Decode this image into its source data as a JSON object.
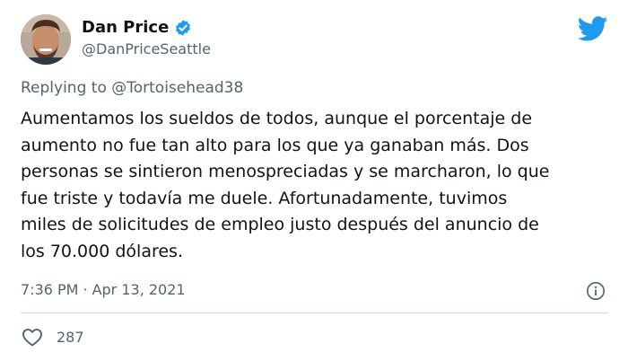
{
  "author": {
    "name": "Dan Price",
    "handle": "@DanPriceSeattle",
    "verified": true
  },
  "reply": {
    "prefix": "Replying to",
    "mention": "@Tortoisehead38"
  },
  "tweet": {
    "lines": [
      "Aumentamos los sueldos de todos, aunque el porcentaje de",
      "aumento no fue tan alto para los que ya ganaban más. Dos",
      "personas se sintieron menospreciadas y se marcharon, lo que",
      "fue triste y todavía me duele. Afortunadamente, tuvimos",
      "miles de solicitudes de empleo justo después del anuncio de",
      "los 70.000 dólares."
    ]
  },
  "meta": {
    "time": "7:36 PM",
    "separator": "·",
    "date": "Apr 13, 2021"
  },
  "engagement": {
    "likes": "287"
  },
  "colors": {
    "twitter_blue": "#1d9bf0",
    "text": "#0f1419",
    "secondary": "#536471"
  },
  "icons": {
    "brand": "twitter-bird-icon",
    "verified": "verified-badge-icon",
    "info": "info-icon",
    "like": "heart-icon"
  }
}
